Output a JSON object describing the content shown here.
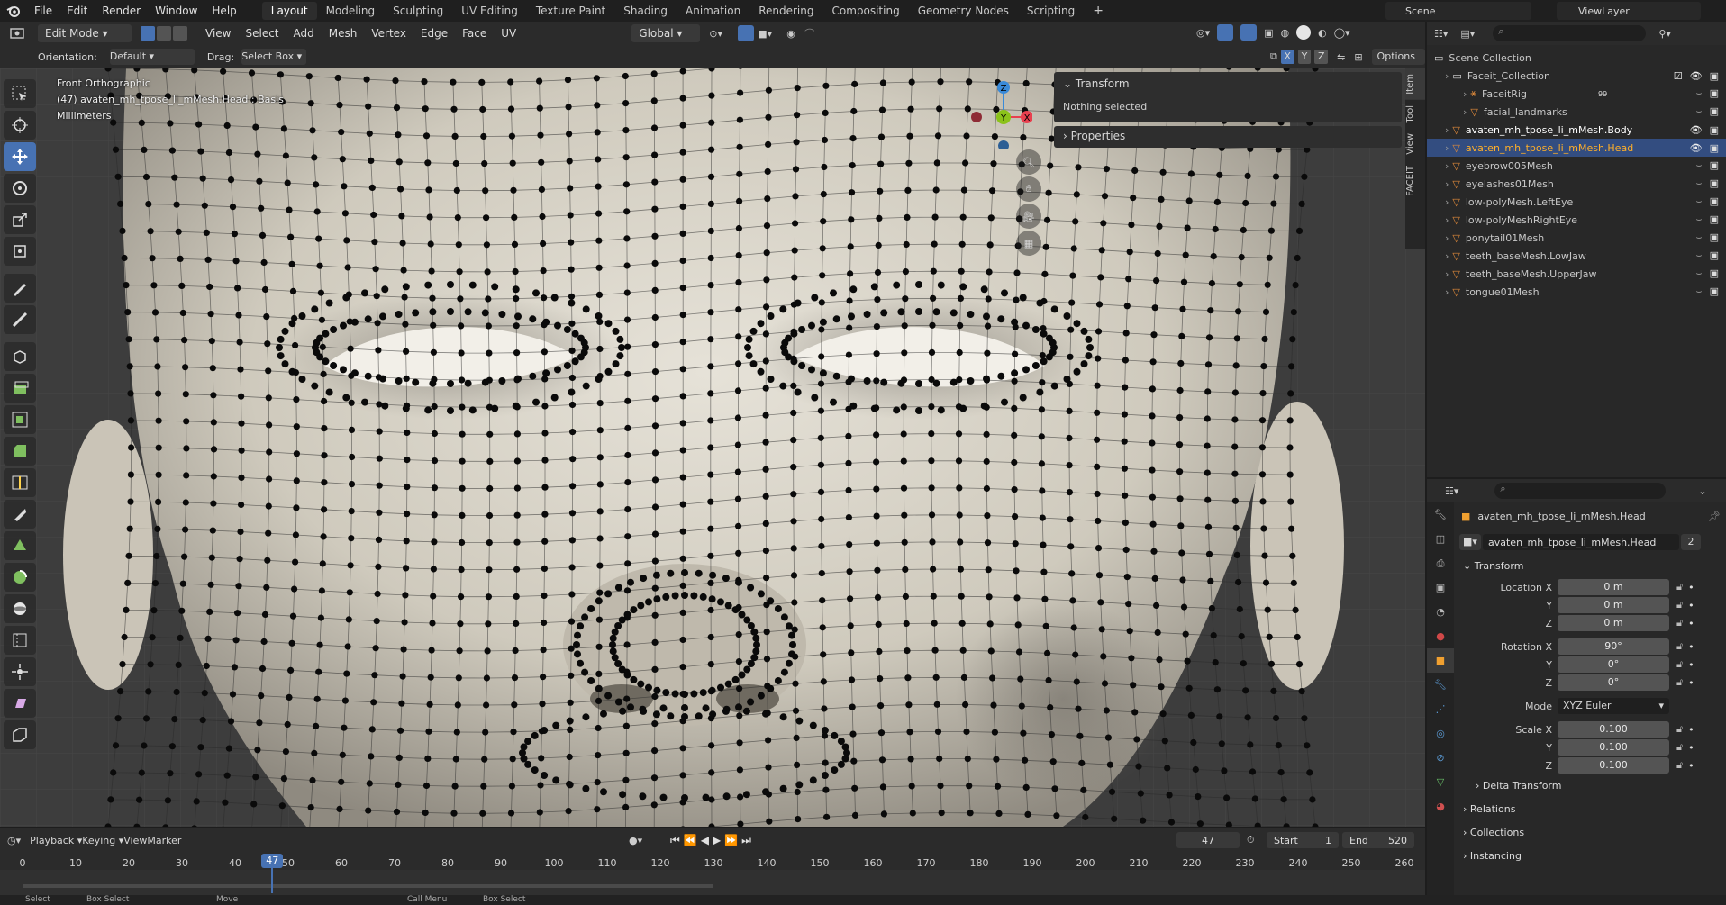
{
  "topbar": {
    "menus": [
      "File",
      "Edit",
      "Render",
      "Window",
      "Help"
    ],
    "workspaces": [
      "Layout",
      "Modeling",
      "Sculpting",
      "UV Editing",
      "Texture Paint",
      "Shading",
      "Animation",
      "Rendering",
      "Compositing",
      "Geometry Nodes",
      "Scripting"
    ],
    "active_workspace": "Layout",
    "scene": "Scene",
    "view_layer": "ViewLayer"
  },
  "viewport_header": {
    "mode": "Edit Mode",
    "menus": [
      "View",
      "Select",
      "Add",
      "Mesh",
      "Vertex",
      "Edge",
      "Face",
      "UV"
    ],
    "transform_orientation": "Global",
    "orientation_label": "Orientation:",
    "orientation_value": "Default",
    "drag_label": "Drag:",
    "drag_value": "Select Box",
    "options_label": "Options",
    "axis_x": "X",
    "axis_y": "Y",
    "axis_z": "Z"
  },
  "viewport_info": {
    "view_name": "Front Orthographic",
    "object_line": "(47) avaten_mh_tpose_li_mMesh.Head : Basis",
    "units": "Millimeters"
  },
  "npanel": {
    "transform_header": "Transform",
    "nothing_selected": "Nothing selected",
    "properties_header": "Properties",
    "tabs": [
      "Item",
      "Tool",
      "View",
      "FACEIT"
    ]
  },
  "gizmo": {
    "z": "Z",
    "y": "Y",
    "x": "X"
  },
  "outliner": {
    "root": "Scene Collection",
    "rows": [
      {
        "name": "Faceit_Collection"
      },
      {
        "name": "FaceitRig"
      },
      {
        "name": "facial_landmarks"
      },
      {
        "name": "avaten_mh_tpose_li_mMesh.Body"
      },
      {
        "name": "avaten_mh_tpose_li_mMesh.Head"
      },
      {
        "name": "eyebrow005Mesh"
      },
      {
        "name": "eyelashes01Mesh"
      },
      {
        "name": "low-polyMesh.LeftEye"
      },
      {
        "name": "low-polyMeshRightEye"
      },
      {
        "name": "ponytail01Mesh"
      },
      {
        "name": "teeth_baseMesh.LowJaw"
      },
      {
        "name": "teeth_baseMesh.UpperJaw"
      },
      {
        "name": "tongue01Mesh"
      }
    ],
    "rig_badge": "99"
  },
  "properties": {
    "object_name": "avaten_mh_tpose_li_mMesh.Head",
    "datablock_name": "avaten_mh_tpose_li_mMesh.Head",
    "users": "2",
    "transform_header": "Transform",
    "location_label": "Location X",
    "location": [
      "0 m",
      "0 m",
      "0 m"
    ],
    "rotation_label": "Rotation X",
    "rotation": [
      "90°",
      "0°",
      "0°"
    ],
    "mode_label": "Mode",
    "mode_value": "XYZ Euler",
    "scale_label": "Scale X",
    "scale": [
      "0.100",
      "0.100",
      "0.100"
    ],
    "axis_y": "Y",
    "axis_z": "Z",
    "delta_header": "Delta Transform",
    "relations_header": "Relations",
    "collections_header": "Collections",
    "instancing_header": "Instancing"
  },
  "timeline": {
    "menus": [
      "Playback",
      "Keying",
      "View",
      "Marker"
    ],
    "current_frame": "47",
    "start_label": "Start",
    "start": "1",
    "end_label": "End",
    "end": "520",
    "ticks": [
      "0",
      "10",
      "20",
      "30",
      "40",
      "50",
      "60",
      "70",
      "80",
      "90",
      "100",
      "110",
      "120",
      "130",
      "140",
      "150",
      "160",
      "170",
      "180",
      "190",
      "200",
      "210",
      "220",
      "230",
      "240",
      "250",
      "260"
    ],
    "playhead": 47
  },
  "statusbar": {
    "items": [
      "Select",
      "Box Select",
      "Move",
      "Call Menu",
      "Box Select"
    ]
  },
  "colors": {
    "accent": "#4772b3",
    "selected_row": "#334d80",
    "active_text": "#ffaf29",
    "axis_x": "#e8404f",
    "axis_y": "#8bc21a",
    "axis_z": "#3a8ad8"
  }
}
